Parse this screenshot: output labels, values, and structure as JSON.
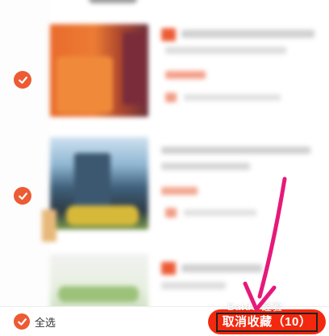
{
  "bottom_bar": {
    "select_all_label": "全选",
    "cancel_button_label": "取消收藏（10）"
  },
  "watermark": "Baidu 经验",
  "colors": {
    "accent": "#ec5b34",
    "button": "#f2290f",
    "annotation_arrow": "#e6197a"
  },
  "items": [
    {
      "checked": true
    },
    {
      "checked": true
    },
    {
      "checked": false
    }
  ]
}
